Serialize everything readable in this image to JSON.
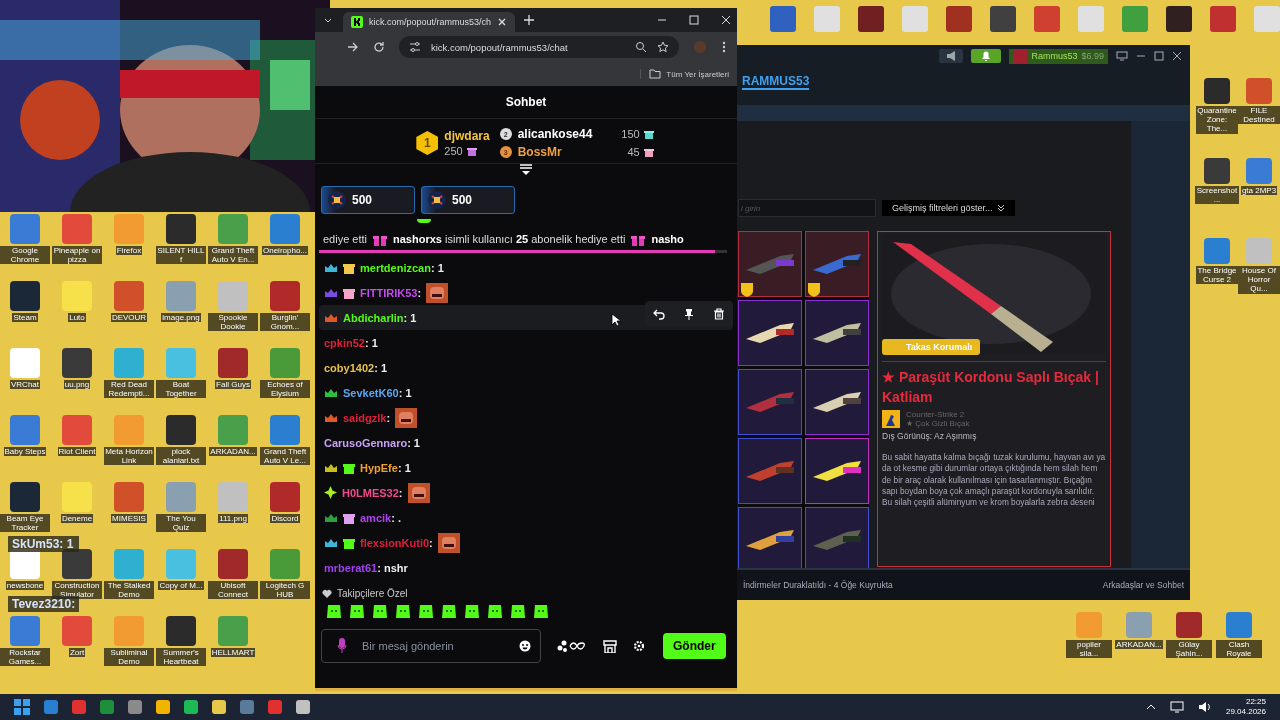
{
  "desktop": {
    "icons": [
      {
        "label": "Google Chrome"
      },
      {
        "label": "Pineapple on pizza"
      },
      {
        "label": "Firefox"
      },
      {
        "label": "SILENT HILL f"
      },
      {
        "label": "Grand Theft Auto V En..."
      },
      {
        "label": "Oneiropho..."
      },
      {
        "label": "Steam"
      },
      {
        "label": "Luto"
      },
      {
        "label": "DEVOUR"
      },
      {
        "label": "image.png"
      },
      {
        "label": "Spookie Dookie"
      },
      {
        "label": "Burglin' Gnom..."
      },
      {
        "label": "VRChat"
      },
      {
        "label": "uu.png"
      },
      {
        "label": "Red Dead Redempti..."
      },
      {
        "label": "Boat Together"
      },
      {
        "label": "Fall Guys"
      },
      {
        "label": "Echoes of Elysium"
      },
      {
        "label": "Baby Steps"
      },
      {
        "label": "Riot Client"
      },
      {
        "label": "Meta Horizon Link"
      },
      {
        "label": "plock alanlari.txt"
      },
      {
        "label": "ARKADAN..."
      },
      {
        "label": "Grand Theft Auto V Le..."
      },
      {
        "label": "Beam Eye Tracker"
      },
      {
        "label": "Deneme"
      },
      {
        "label": "MIMESIS"
      },
      {
        "label": "The You Quiz"
      },
      {
        "label": "111.png"
      },
      {
        "label": "Discord"
      },
      {
        "label": "newsbone"
      },
      {
        "label": "Construction Simulator"
      },
      {
        "label": "The Stalked Demo"
      },
      {
        "label": "Copy of M..."
      },
      {
        "label": "Ubisoft Connect"
      },
      {
        "label": "Logitech G HUB"
      },
      {
        "label": "Rockstar Games..."
      },
      {
        "label": "Zort"
      },
      {
        "label": "Subliminal Demo"
      },
      {
        "label": "Summer's Heartbeat"
      },
      {
        "label": "HELLMART"
      }
    ],
    "right_icons": [
      {
        "label": "Quarantine Zone: The..."
      },
      {
        "label": "FILE Destined"
      },
      {
        "label": "Screenshot..."
      },
      {
        "label": "gta 2MP3"
      },
      {
        "label": "The Bridge Curse 2"
      },
      {
        "label": "House Of Horror Qu..."
      }
    ],
    "bottom_icons": [
      {
        "label": "popiler sila..."
      },
      {
        "label": "ARKADAN..."
      },
      {
        "label": "Gülay Şahin..."
      },
      {
        "label": "Clash Royale"
      }
    ],
    "overlay_chat": [
      {
        "text": "SkUm53: 1"
      },
      {
        "text": "Tevez3210:"
      }
    ]
  },
  "browser": {
    "tab_title": "kick.com/popout/rammus53/ch",
    "url": "kick.com/popout/rammus53/chat",
    "bookmarks": "Tüm Yer İşaretleri"
  },
  "chat": {
    "title": "Sohbet",
    "leaderboard": [
      {
        "rank": "1",
        "user": "djwdara",
        "amount": "250",
        "color": "#f5c542"
      },
      {
        "rank": "2",
        "user": "alicankose44",
        "amount": "150",
        "color": "#ffffff"
      },
      {
        "rank": "3",
        "user": "BossMr",
        "amount": "45",
        "color": "#f0a040"
      }
    ],
    "gift_cards": [
      {
        "amount": "500"
      },
      {
        "amount": "500"
      }
    ],
    "marquee": {
      "level": 0.97,
      "segments": [
        {
          "kind": "text",
          "text": "ediye etti"
        },
        {
          "kind": "gift"
        },
        {
          "kind": "text",
          "text": "**nashorxs** isimli kullanıcı **25** abonelik hediye etti"
        },
        {
          "kind": "gift"
        },
        {
          "kind": "text",
          "text": "**nasho**"
        }
      ]
    },
    "messages": [
      {
        "user": "mertdenizcan",
        "color": "#53fc18",
        "badges": [
          {
            "kind": "sub",
            "color": "#3fb6d8"
          },
          {
            "kind": "gift",
            "color": "#f2c94c"
          }
        ],
        "text": ": 1"
      },
      {
        "user": "FITTIRIK53",
        "color": "#c64bf0",
        "badges": [
          {
            "kind": "sub",
            "color": "#7a4de0"
          },
          {
            "kind": "gift",
            "color": "#f5a3c8"
          }
        ],
        "text": ":",
        "emote": true
      },
      {
        "user": "Abdicharlin",
        "color": "#53fc18",
        "badges": [
          {
            "kind": "sub",
            "color": "#e0582a"
          }
        ],
        "text": ": 1",
        "hovered": true
      },
      {
        "user": "cpkin52",
        "color": "#e0203a",
        "text": ": 1"
      },
      {
        "user": "coby1402",
        "color": "#e8c24a",
        "text": ": 1"
      },
      {
        "user": "SevketK60",
        "color": "#5aa8f0",
        "badges": [
          {
            "kind": "sub",
            "color": "#2fbf40"
          }
        ],
        "text": ": 1"
      },
      {
        "user": "saidgzlk",
        "color": "#e0203a",
        "badges": [
          {
            "kind": "sub",
            "color": "#e0582a"
          }
        ],
        "text": ":",
        "emote": true
      },
      {
        "user": "CarusoGennaro",
        "color": "#c9a0f5",
        "text": ": 1"
      },
      {
        "user": "HypEfe",
        "color": "#f0a030",
        "badges": [
          {
            "kind": "sub",
            "color": "#c8c020"
          },
          {
            "kind": "gift",
            "color": "#53fc18"
          }
        ],
        "text": ": 1"
      },
      {
        "user": "H0LMES32",
        "color": "#f04a8a",
        "badges": [
          {
            "kind": "diamond",
            "color": "#a8f020"
          }
        ],
        "text": ":",
        "emote": true
      },
      {
        "user": "amcik",
        "color": "#b040f0",
        "badges": [
          {
            "kind": "sub",
            "color": "#2fa040"
          },
          {
            "kind": "gift",
            "color": "#e0a0f0"
          }
        ],
        "text": ": ."
      },
      {
        "user": "flexsionKuti0",
        "color": "#e0203a",
        "badges": [
          {
            "kind": "sub",
            "color": "#3fb6d8"
          },
          {
            "kind": "gift",
            "color": "#53fc18"
          }
        ],
        "text": ":",
        "emote": true
      },
      {
        "user": "mrberat61",
        "color": "#a040f0",
        "text": ": nshr"
      }
    ],
    "emote_section": "Takipçilere Özel",
    "input": {
      "placeholder": "Bir mesaj gönderin"
    },
    "send_button": "Gönder"
  },
  "steam": {
    "account": "Rammus53",
    "wallet": "$6.99",
    "profile_tab": "RAMMUS53",
    "search": {
      "placeholder": "i girin"
    },
    "filters_button": "Gelişmiş filtreleri göster...",
    "items": [
      {
        "color": "#b03040",
        "trade_protected": true
      },
      {
        "color": "#b03040",
        "trade_protected": true
      },
      {
        "color": "#8a2fd0"
      },
      {
        "color": "#8a2fd0"
      },
      {
        "color": "#4050d0"
      },
      {
        "color": "#8a2fd0"
      },
      {
        "color": "#4050d0"
      },
      {
        "color": "#c030c0"
      },
      {
        "color": "#4050d0"
      },
      {
        "color": "#4050d0"
      }
    ],
    "detail": {
      "badge": "Takas Korumalı",
      "title": "★ Paraşüt Kordonu Saplı Bıçak | Katliam",
      "game": "Counter-Strike 2",
      "rarity": "★ Çok Gizli Bıçak",
      "exterior": "Dış Görünüş: Az Aşınmış",
      "description": "Bu sabit hayatta kalma bıçağı tuzak kurulumu, hayvan avı ya da ot kesme gibi durumlar ortaya çıktığında hem silah hem de bir araç olarak kullanılması için tasarlanmıştır. Bıçağın sapı boydan boya çok amaçlı paraşüt kordonuyla sarılıdır. Bu silah çeşitli alüminyum ve krom boyalarla zebra deseni"
    },
    "downloads": "İndirmeler Duraklatıldı - 4 Öğe Kuyrukta",
    "friends": "Arkadaşlar ve Sohbet"
  },
  "taskbar": {
    "time": "22:25",
    "date": "29.04.2026"
  }
}
